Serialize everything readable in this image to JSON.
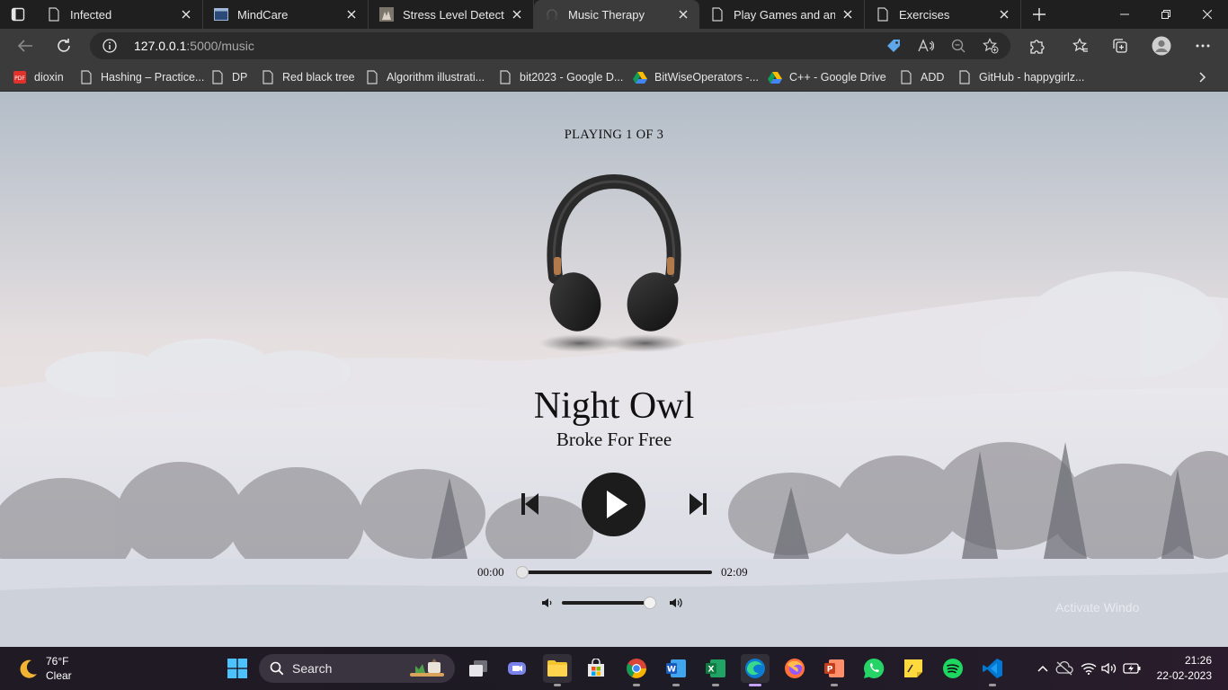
{
  "browser": {
    "tabs": [
      {
        "title": "Infected",
        "active": false
      },
      {
        "title": "MindCare",
        "active": false
      },
      {
        "title": "Stress Level Detection",
        "active": false
      },
      {
        "title": "Music Therapy",
        "active": true
      },
      {
        "title": "Play Games and answe",
        "active": false
      },
      {
        "title": "Exercises",
        "active": false
      }
    ],
    "url_host": "127.0.0.1",
    "url_rest": ":5000/music",
    "favorites": [
      {
        "label": "dioxin",
        "icon": "pdf-icon"
      },
      {
        "label": "Hashing – Practice...",
        "icon": "page-icon"
      },
      {
        "label": "DP",
        "icon": "page-icon"
      },
      {
        "label": "Red black tree",
        "icon": "page-icon"
      },
      {
        "label": "Algorithm illustrati...",
        "icon": "page-icon"
      },
      {
        "label": "bit2023 - Google D...",
        "icon": "page-icon"
      },
      {
        "label": "BitWiseOperators -...",
        "icon": "google-drive-icon"
      },
      {
        "label": "C++ - Google Drive",
        "icon": "google-drive-icon"
      },
      {
        "label": "ADD",
        "icon": "page-icon"
      },
      {
        "label": "GitHub - happygirlz...",
        "icon": "page-icon"
      }
    ]
  },
  "player": {
    "status": "PLAYING 1 OF 3",
    "title": "Night Owl",
    "artist": "Broke For Free",
    "current_time": "00:00",
    "duration": "02:09",
    "progress": 0.0,
    "volume": 0.95
  },
  "watermark": "Activate Windo",
  "taskbar": {
    "temperature": "76°F",
    "condition": "Clear",
    "search_label": "Search",
    "time": "21:26",
    "date": "22-02-2023"
  }
}
